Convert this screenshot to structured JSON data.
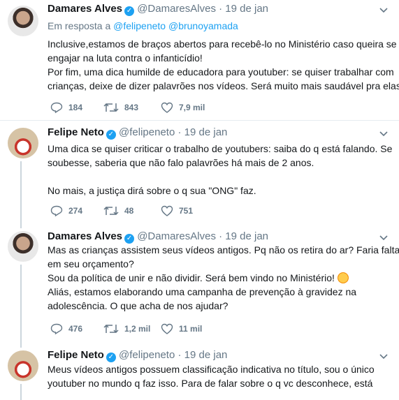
{
  "tweets": [
    {
      "name": "Damares Alves",
      "handle": "@DamaresAlves",
      "separator": "·",
      "date": "19 de jan",
      "reply_prefix": "Em resposta a",
      "reply_users": [
        "@felipeneto",
        "@brunoyamada"
      ],
      "lines": [
        "Inclusive,estamos de braços abertos para recebê-lo no Ministério  caso queira se",
        "engajar na luta contra o infanticídio!",
        "Por fim, uma dica humilde de educadora para youtuber: se quiser trabalhar com",
        "crianças, deixe de dizer palavrões nos vídeos. Será muito mais saudável pra elas!"
      ],
      "replies": "184",
      "retweets": "843",
      "likes": "7,9 mil"
    },
    {
      "name": "Felipe Neto",
      "handle": "@felipeneto",
      "separator": "·",
      "date": "19 de jan",
      "lines": [
        "Uma dica se quiser criticar o trabalho de youtubers: saiba do q está falando. Se",
        "soubesse, saberia que não falo palavrões há mais de 2 anos.",
        "",
        "No mais, a justiça dirá sobre o q sua \"ONG\" faz."
      ],
      "replies": "274",
      "retweets": "48",
      "likes": "751"
    },
    {
      "name": "Damares Alves",
      "handle": "@DamaresAlves",
      "separator": "·",
      "date": "19 de jan",
      "lines": [
        "Mas as crianças assistem seus vídeos antigos. Pq não os retira do ar? Faria falta",
        "em seu orçamento?",
        "Sou da política de unir e não dividir. Será bem vindo no Ministério!",
        "Aliás, estamos elaborando uma campanha de prevenção à gravidez na",
        "adolescência. O que acha de nos ajudar?"
      ],
      "replies": "476",
      "retweets": "1,2 mil",
      "likes": "11 mil"
    },
    {
      "name": "Felipe Neto",
      "handle": "@felipeneto",
      "separator": "·",
      "date": "19 de jan",
      "lines": [
        "Meus vídeos antigos possuem classificação indicativa no título, sou o único",
        "youtuber no mundo q faz isso. Para de falar sobre o q vc desconhece, está"
      ]
    }
  ],
  "icons": {
    "verified": "verified-badge-icon",
    "more": "chevron-down-icon",
    "reply": "reply-icon",
    "retweet": "retweet-icon",
    "like": "heart-icon"
  },
  "colors": {
    "link": "#1da1f2",
    "secondary": "#657786",
    "text": "#14171a",
    "divider": "#e6ecf0"
  }
}
